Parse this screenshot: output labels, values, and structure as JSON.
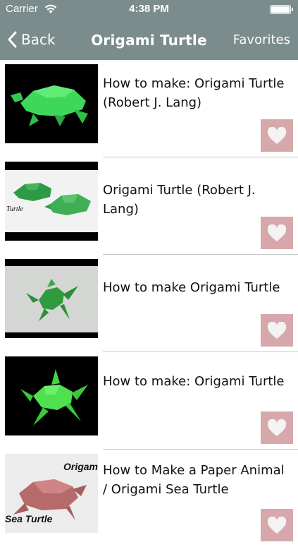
{
  "status_bar": {
    "carrier": "Carrier",
    "time": "4:38 PM"
  },
  "nav": {
    "back_label": "Back",
    "title": "Origami Turtle",
    "favorites_label": "Favorites"
  },
  "colors": {
    "bar": "#7b8c8c",
    "heart_bg": "#d6a8ab",
    "separator": "#c8c7cc"
  },
  "items": [
    {
      "title": "How to make: Origami Turtle (Robert J. Lang)",
      "thumbnail": "green-paper-turtle-on-black"
    },
    {
      "title": "Origami Turtle (Robert J. Lang)",
      "thumbnail": "two-green-turtles-on-white",
      "thumb_caption": "Turtle"
    },
    {
      "title": "How to make Origami Turtle",
      "thumbnail": "green-sea-turtle-on-grey"
    },
    {
      "title": "How to make: Origami Turtle",
      "thumbnail": "green-sea-turtle-on-black"
    },
    {
      "title": "How to Make a Paper Animal / Origami Sea Turtle",
      "thumbnail": "pink-sea-turtle",
      "thumb_caption_top": "Origam",
      "thumb_caption_bottom": "Sea Turtle"
    }
  ]
}
